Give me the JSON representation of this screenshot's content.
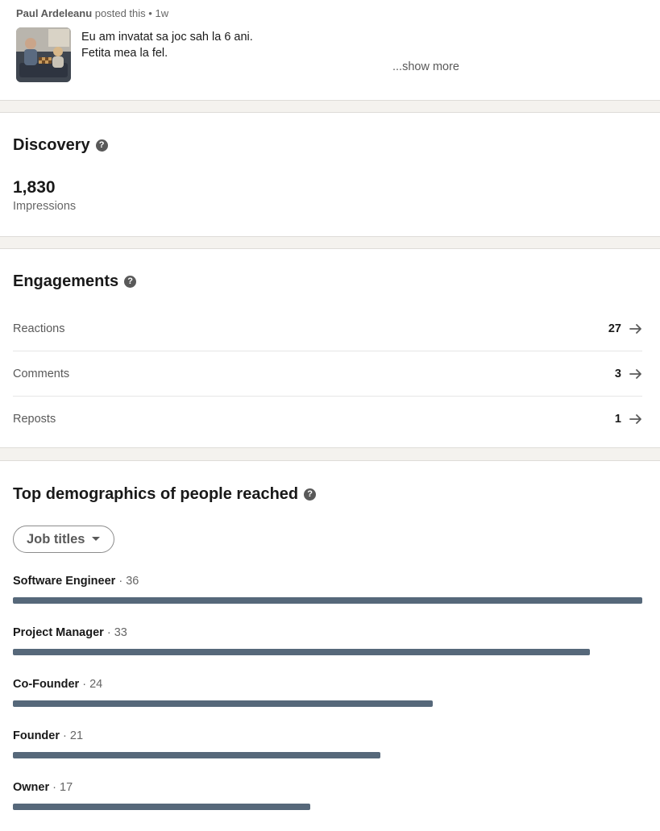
{
  "post": {
    "author": "Paul Ardeleanu",
    "action": "posted this",
    "separator": "•",
    "age": "1w",
    "line1": "Eu am invatat sa joc sah la 6 ani.",
    "line2": "Fetita mea la fel.",
    "show_more": "...show more"
  },
  "discovery": {
    "title": "Discovery",
    "help_icon": "?",
    "impressions_value": "1,830",
    "impressions_label": "Impressions"
  },
  "engagements": {
    "title": "Engagements",
    "help_icon": "?",
    "rows": [
      {
        "label": "Reactions",
        "value": "27",
        "icon": "arrow-right-icon"
      },
      {
        "label": "Comments",
        "value": "3",
        "icon": "arrow-right-icon"
      },
      {
        "label": "Reposts",
        "value": "1",
        "icon": "arrow-right-icon"
      }
    ]
  },
  "demographics": {
    "title": "Top demographics of people reached",
    "help_icon": "?",
    "dropdown_label": "Job titles",
    "separator": "·",
    "bar_color": "#56687a",
    "rows": [
      {
        "title": "Software Engineer",
        "count": "36",
        "value": 36
      },
      {
        "title": "Project Manager",
        "count": "33",
        "value": 33
      },
      {
        "title": "Co-Founder",
        "count": "24",
        "value": 24
      },
      {
        "title": "Founder",
        "count": "21",
        "value": 21
      },
      {
        "title": "Owner",
        "count": "17",
        "value": 17
      }
    ]
  }
}
